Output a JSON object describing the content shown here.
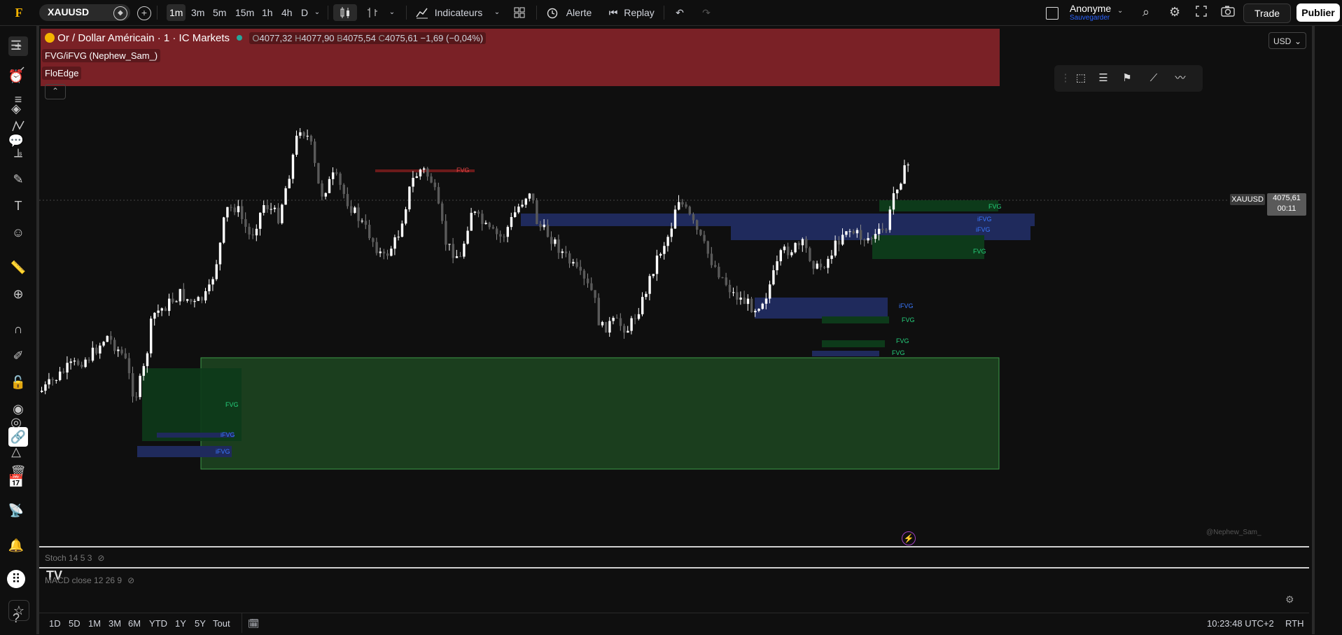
{
  "topbar": {
    "symbol": "XAUUSD",
    "timeframes": [
      "1m",
      "3m",
      "5m",
      "15m",
      "1h",
      "4h",
      "D"
    ],
    "active_timeframe": "1m",
    "indicators_label": "Indicateurs",
    "alert_label": "Alerte",
    "replay_label": "Replay",
    "user_name": "Anonyme",
    "user_status": "Sauvegarder",
    "trade_label": "Trade",
    "publish_label": "Publier"
  },
  "legend": {
    "title": "Or / Dollar Américain · 1 · IC Markets",
    "o_label": "O",
    "o_value": "4077,32",
    "h_label": "H",
    "h_value": "4077,90",
    "b_label": "B",
    "b_value": "4075,54",
    "c_label": "C",
    "c_value": "4075,61",
    "change": "−1,69 (−0,04%)",
    "indicator1": "FVG/iFVG (Nephew_Sam_)",
    "indicator2": "FloEdge"
  },
  "chart": {
    "currency": "USD",
    "price_symbol": "XAUUSD",
    "price": "4075,61",
    "countdown": "00:11",
    "watermark": "@Nephew_Sam_",
    "zone_labels": {
      "fvg": "FVG",
      "ifvg": "iFVG",
      "ifvg_short": "iF"
    }
  },
  "panes": {
    "stoch": "Stoch 14 5 3",
    "macd": "MACD close 12 26 9"
  },
  "bottombar": {
    "ranges": [
      "1D",
      "5D",
      "1M",
      "3M",
      "6M",
      "YTD",
      "1Y",
      "5Y",
      "Tout"
    ],
    "time": "10:23:48 UTC+2",
    "session": "RTH"
  },
  "colors": {
    "legend_bg": "#7a2126",
    "fvg_green": "#1e6b2f",
    "ifvg_blue": "#1f2a5c",
    "candle_up": "#ffffff",
    "candle_down": "#5a5a5a",
    "accent_green": "#26a69a"
  }
}
